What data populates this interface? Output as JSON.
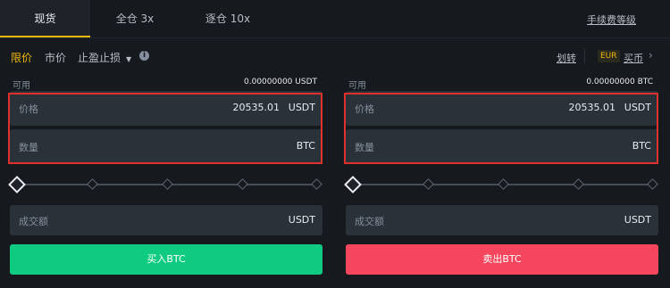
{
  "tabs": [
    {
      "label": "现货"
    },
    {
      "label": "全仓 3x"
    },
    {
      "label": "逐仓 10x"
    }
  ],
  "fee_level_label": "手续费等级",
  "order_types": {
    "limit": "限价",
    "market": "市价",
    "stop": "止盈止损"
  },
  "transfer_label": "划转",
  "currency_badge": "EUR",
  "buy_crypto_label": "买币",
  "buy_panel": {
    "available_label": "可用",
    "available_value": "0.00000000 USDT",
    "price_label": "价格",
    "price_value": "20535.01",
    "price_unit": "USDT",
    "amount_label": "数量",
    "amount_unit": "BTC",
    "total_label": "成交额",
    "total_unit": "USDT",
    "button_label": "买入BTC"
  },
  "sell_panel": {
    "available_label": "可用",
    "available_value": "0.00000000 BTC",
    "price_label": "价格",
    "price_value": "20535.01",
    "price_unit": "USDT",
    "amount_label": "数量",
    "amount_unit": "BTC",
    "total_label": "成交额",
    "total_unit": "USDT",
    "button_label": "卖出BTC"
  },
  "colors": {
    "accent": "#f0b90b",
    "buy": "#0ecb81",
    "sell": "#f6465d",
    "highlight_box": "#e0312e"
  },
  "icons": {
    "info": "info-icon",
    "dropdown": "caret-down-icon",
    "chevron": "chevron-right-icon"
  }
}
